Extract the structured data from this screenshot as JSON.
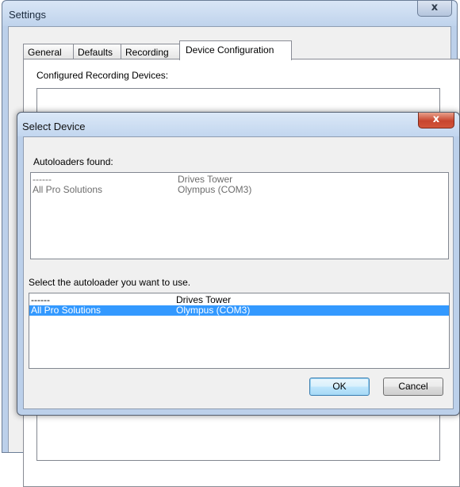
{
  "settings_window": {
    "title": "Settings",
    "close_symbol": "x",
    "tabs": [
      {
        "label": "General"
      },
      {
        "label": "Defaults"
      },
      {
        "label": "Recording"
      },
      {
        "label": "Device Configuration"
      }
    ],
    "selected_tab": "Device Configuration",
    "configured_devices_label": "Configured Recording Devices:"
  },
  "select_device_dialog": {
    "title": "Select Device",
    "close_symbol": "x",
    "autoloaders_found_label": "Autoloaders found:",
    "autoloaders_found": [
      {
        "name": "------",
        "device": "Drives Tower"
      },
      {
        "name": "All Pro Solutions",
        "device": "Olympus (COM3)"
      }
    ],
    "select_label": "Select the autoloader you want to use.",
    "autoloader_choices": [
      {
        "name": "------",
        "device": "Drives Tower",
        "selected": false
      },
      {
        "name": "All Pro Solutions",
        "device": "Olympus (COM3)",
        "selected": true
      }
    ],
    "ok_label": "OK",
    "cancel_label": "Cancel"
  },
  "colors": {
    "selection": "#3399ff",
    "close_button_active": "#c8452e",
    "window_frame": "#bcd0ea"
  }
}
